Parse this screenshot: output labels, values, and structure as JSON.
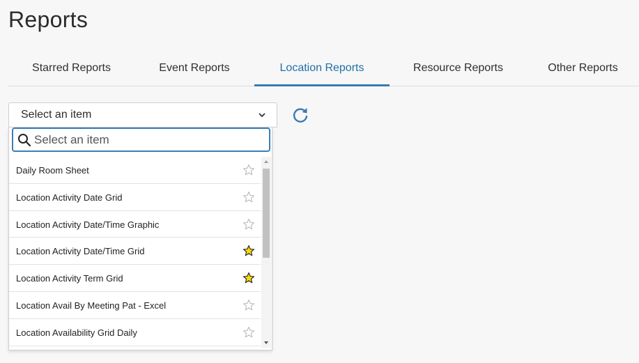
{
  "page": {
    "title": "Reports"
  },
  "tabs": [
    {
      "label": "Starred Reports"
    },
    {
      "label": "Event Reports"
    },
    {
      "label": "Location Reports",
      "active": true
    },
    {
      "label": "Resource Reports"
    },
    {
      "label": "Other Reports"
    }
  ],
  "select": {
    "value": "Select an item"
  },
  "search": {
    "placeholder": "Select an item"
  },
  "reports": [
    {
      "label": "Daily Room Sheet",
      "starred": false
    },
    {
      "label": "Location Activity Date Grid",
      "starred": false
    },
    {
      "label": "Location Activity Date/Time Graphic",
      "starred": false
    },
    {
      "label": "Location Activity Date/Time Grid",
      "starred": true
    },
    {
      "label": "Location Activity Term Grid",
      "starred": true
    },
    {
      "label": "Location Avail By Meeting Pat - Excel",
      "starred": false
    },
    {
      "label": "Location Availability Grid Daily",
      "starred": false
    }
  ],
  "colors": {
    "accent": "#3b7ab0",
    "active_tab_text": "#1f6fa8",
    "star_filled": "#f5d90a",
    "star_outline": "#b5b5b5"
  },
  "icons": {
    "refresh": "refresh-icon",
    "search": "search-icon",
    "caret": "chevron-down-icon",
    "star": "star-icon"
  }
}
